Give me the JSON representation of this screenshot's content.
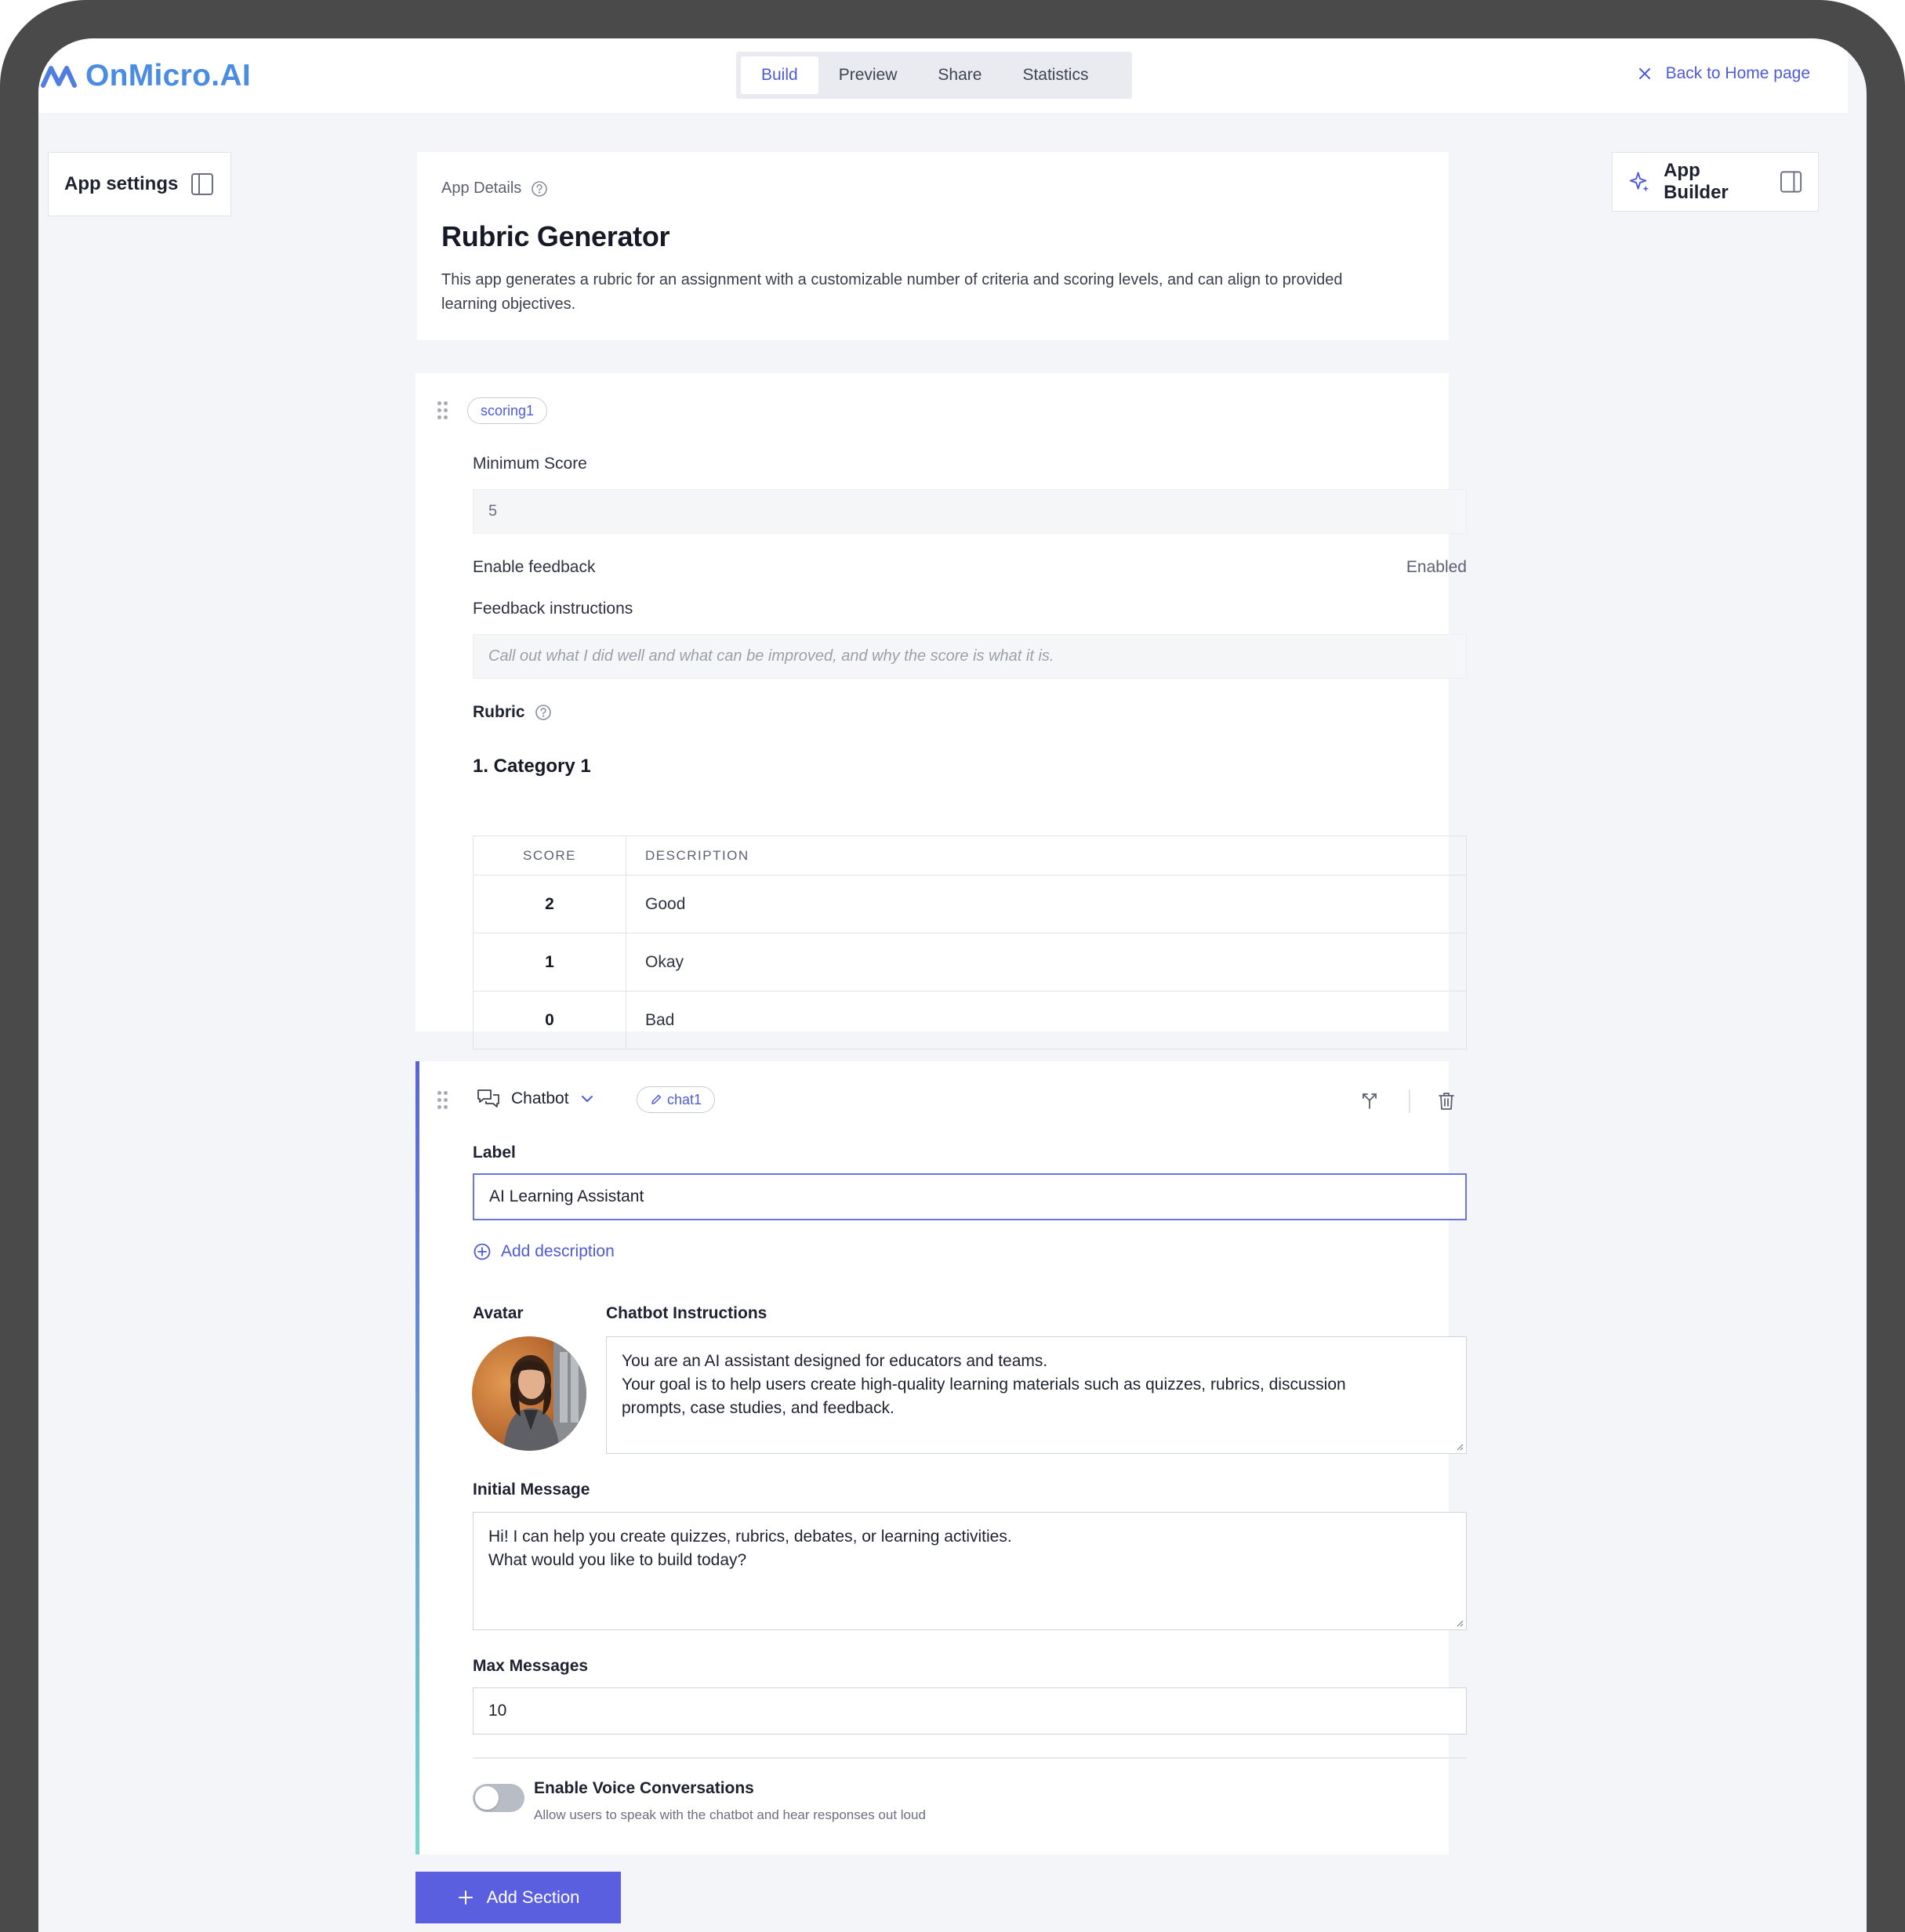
{
  "header": {
    "logo_text": "OnMicro.AI",
    "tabs": [
      {
        "label": "Build",
        "active": true
      },
      {
        "label": "Preview",
        "active": false
      },
      {
        "label": "Share",
        "active": false
      },
      {
        "label": "Statistics",
        "active": false
      }
    ],
    "back_link": "Back to Home page"
  },
  "side": {
    "app_settings": "App settings",
    "app_builder": "App Builder"
  },
  "app_details": {
    "label": "App Details",
    "title": "Rubric Generator",
    "description": "This app generates a rubric for an assignment with a customizable number of criteria and scoring levels, and can align to provided learning objectives."
  },
  "scoring": {
    "tag": "scoring1",
    "min_score_label": "Minimum Score",
    "min_score_value": "5",
    "enable_feedback_label": "Enable feedback",
    "enable_feedback_value": "Enabled",
    "feedback_instructions_label": "Feedback instructions",
    "feedback_instructions_placeholder": "Call out what I did well and what can be improved, and why the score is what it is.",
    "rubric_label": "Rubric",
    "category_title": "1. Category 1",
    "table": {
      "headers": [
        "SCORE",
        "DESCRIPTION"
      ],
      "rows": [
        {
          "score": "2",
          "description": "Good"
        },
        {
          "score": "1",
          "description": "Okay"
        },
        {
          "score": "0",
          "description": "Bad"
        }
      ]
    }
  },
  "chatbot": {
    "type_label": "Chatbot",
    "tag": "chat1",
    "label_label": "Label",
    "label_value": "AI Learning Assistant",
    "add_description": "Add description",
    "avatar_label": "Avatar",
    "instructions_label": "Chatbot Instructions",
    "instructions_lines": [
      "You are an AI assistant designed for educators and teams.",
      "Your goal is to help users create high-quality learning materials such as quizzes, rubrics, discussion",
      "prompts, case studies, and feedback."
    ],
    "initial_message_label": "Initial Message",
    "initial_message_lines": [
      "Hi! I can help you create quizzes, rubrics, debates, or learning activities.",
      "What would you like to build today?"
    ],
    "max_messages_label": "Max Messages",
    "max_messages_value": "10",
    "voice_title": "Enable Voice Conversations",
    "voice_subtitle": "Allow users to speak with the chatbot and hear responses out loud",
    "voice_enabled": false
  },
  "footer": {
    "add_section": "Add Section"
  },
  "colors": {
    "accent": "#4f5bd5",
    "button": "#5a5fe0",
    "logo": "#4a8de0"
  },
  "icons": [
    "logo-icon",
    "close-icon",
    "sidebar-panel-icon",
    "sparkle-icon",
    "help-icon",
    "drag-handle-icon",
    "chat-bubbles-icon",
    "chevron-down-icon",
    "pencil-icon",
    "merge-icon",
    "trash-icon",
    "plus-circle-icon",
    "plus-icon"
  ]
}
